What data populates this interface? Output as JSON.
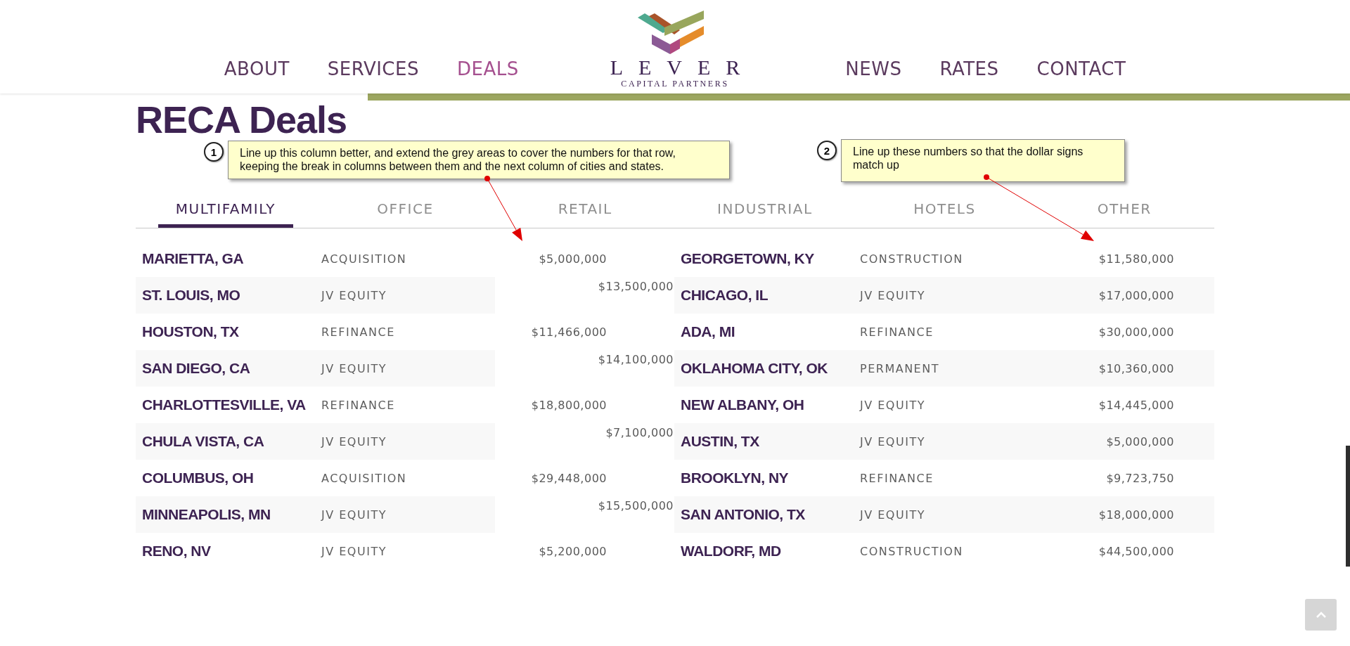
{
  "nav": {
    "left": [
      {
        "label": "ABOUT",
        "selected": false
      },
      {
        "label": "SERVICES",
        "selected": false
      },
      {
        "label": "DEALS",
        "selected": true
      }
    ],
    "logo": {
      "name": "LEVER",
      "tagline": "CAPITAL PARTNERS"
    },
    "right": [
      {
        "label": "NEWS",
        "selected": false
      },
      {
        "label": "RATES",
        "selected": false
      },
      {
        "label": "CONTACT",
        "selected": false
      }
    ]
  },
  "heading": "RECA Deals",
  "annotations": [
    {
      "number": "1",
      "text": "Line up this column better, and extend the grey areas to cover the numbers for that row, keeping the break in columns between them and the next column of cities and states."
    },
    {
      "number": "2",
      "text": "Line up these numbers so that the dollar signs match up"
    }
  ],
  "tabs": [
    {
      "label": "MULTIFAMILY",
      "selected": true
    },
    {
      "label": "OFFICE",
      "selected": false
    },
    {
      "label": "RETAIL",
      "selected": false
    },
    {
      "label": "INDUSTRIAL",
      "selected": false
    },
    {
      "label": "HOTELS",
      "selected": false
    },
    {
      "label": "OTHER",
      "selected": false
    }
  ],
  "deals_left": [
    {
      "city": "MARIETTA, GA",
      "type": "ACQUISITION",
      "amount": "$5,000,000",
      "misaligned": false
    },
    {
      "city": "ST. LOUIS, MO",
      "type": "JV EQUITY",
      "amount": "$13,500,000",
      "misaligned": true
    },
    {
      "city": "HOUSTON, TX",
      "type": "REFINANCE",
      "amount": "$11,466,000",
      "misaligned": false
    },
    {
      "city": "SAN DIEGO, CA",
      "type": "JV EQUITY",
      "amount": "$14,100,000",
      "misaligned": true
    },
    {
      "city": "CHARLOTTESVILLE, VA",
      "type": "REFINANCE",
      "amount": "$18,800,000",
      "misaligned": false
    },
    {
      "city": "CHULA VISTA, CA",
      "type": "JV EQUITY",
      "amount": "$7,100,000",
      "misaligned": true
    },
    {
      "city": "COLUMBUS, OH",
      "type": "ACQUISITION",
      "amount": "$29,448,000",
      "misaligned": false
    },
    {
      "city": "MINNEAPOLIS, MN",
      "type": "JV EQUITY",
      "amount": "$15,500,000",
      "misaligned": true
    },
    {
      "city": "RENO, NV",
      "type": "JV EQUITY",
      "amount": "$5,200,000",
      "misaligned": false
    }
  ],
  "deals_right": [
    {
      "city": "GEORGETOWN, KY",
      "type": "CONSTRUCTION",
      "amount": "$11,580,000"
    },
    {
      "city": "CHICAGO, IL",
      "type": "JV EQUITY",
      "amount": "$17,000,000"
    },
    {
      "city": "ADA, MI",
      "type": "REFINANCE",
      "amount": "$30,000,000"
    },
    {
      "city": "OKLAHOMA CITY, OK",
      "type": "PERMANENT",
      "amount": "$10,360,000"
    },
    {
      "city": "NEW ALBANY, OH",
      "type": "JV EQUITY",
      "amount": "$14,445,000"
    },
    {
      "city": "AUSTIN, TX",
      "type": "JV EQUITY",
      "amount": "$5,000,000"
    },
    {
      "city": "BROOKLYN, NY",
      "type": "REFINANCE",
      "amount": "$9,723,750"
    },
    {
      "city": "SAN ANTONIO, TX",
      "type": "JV EQUITY",
      "amount": "$18,000,000"
    },
    {
      "city": "WALDORF, MD",
      "type": "CONSTRUCTION",
      "amount": "$44,500,000"
    }
  ]
}
